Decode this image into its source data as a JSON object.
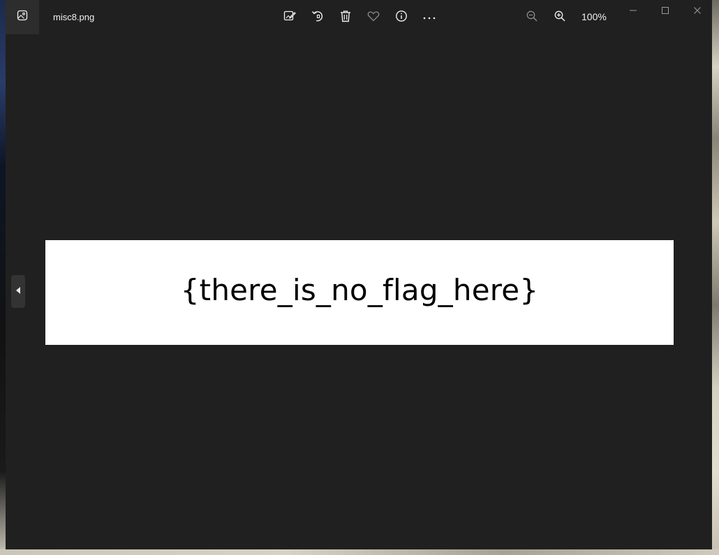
{
  "window": {
    "file_name": "misc8.png",
    "zoom_level": "100%"
  },
  "toolbar": {
    "buttons": [
      {
        "name": "edit-icon",
        "tooltip": ""
      },
      {
        "name": "rotate-icon",
        "tooltip": ""
      },
      {
        "name": "delete-icon",
        "tooltip": ""
      },
      {
        "name": "heart-icon",
        "tooltip": ""
      },
      {
        "name": "info-icon",
        "tooltip": ""
      },
      {
        "name": "more-icon",
        "tooltip": ""
      }
    ],
    "more_glyph": "···"
  },
  "image": {
    "text": "{there_is_no_flag_here}",
    "background": "#ffffff",
    "text_color": "#000000"
  },
  "colors": {
    "window_bg": "#202020",
    "icon": "#f0f0f0",
    "icon_dim": "#8a8a8a"
  }
}
